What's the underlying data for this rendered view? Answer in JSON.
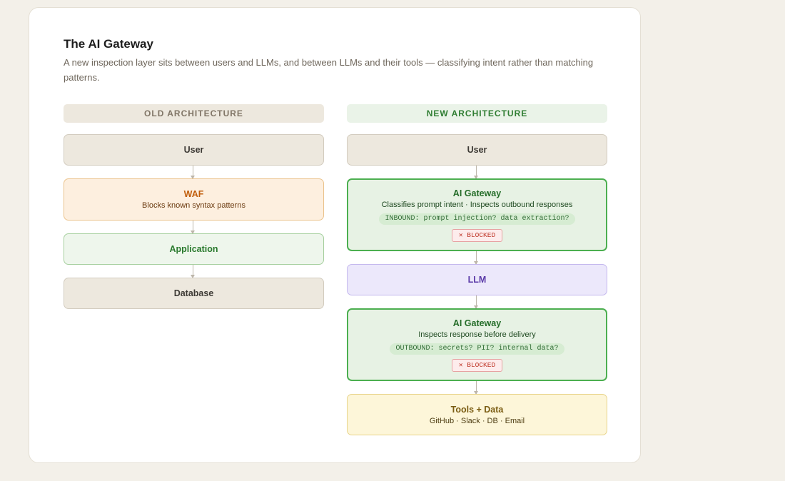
{
  "header": {
    "title": "The AI Gateway",
    "subtitle": "A new inspection layer sits between users and LLMs, and between LLMs and their tools — classifying intent rather than matching patterns."
  },
  "old": {
    "header": "OLD ARCHITECTURE",
    "user": "User",
    "waf": {
      "name": "WAF",
      "desc": "Blocks known syntax patterns"
    },
    "application": "Application",
    "database": "Database"
  },
  "new": {
    "header": "NEW ARCHITECTURE",
    "user": "User",
    "gateway_in": {
      "name": "AI Gateway",
      "desc": "Classifies prompt intent · Inspects outbound responses",
      "check": "INBOUND: prompt injection? data extraction?",
      "status": "✕ BLOCKED"
    },
    "llm": "LLM",
    "gateway_out": {
      "name": "AI Gateway",
      "desc": "Inspects response before delivery",
      "check": "OUTBOUND: secrets? PII? internal data?",
      "status": "✕ BLOCKED"
    },
    "tools": {
      "name": "Tools + Data",
      "desc": "GitHub · Slack · DB · Email"
    }
  },
  "colors": {
    "gateway": "#4caf50",
    "waf": "#c15e0c",
    "llm": "#5a3aa8",
    "tools": "#7a5c12",
    "blocked": "#c0392b"
  }
}
